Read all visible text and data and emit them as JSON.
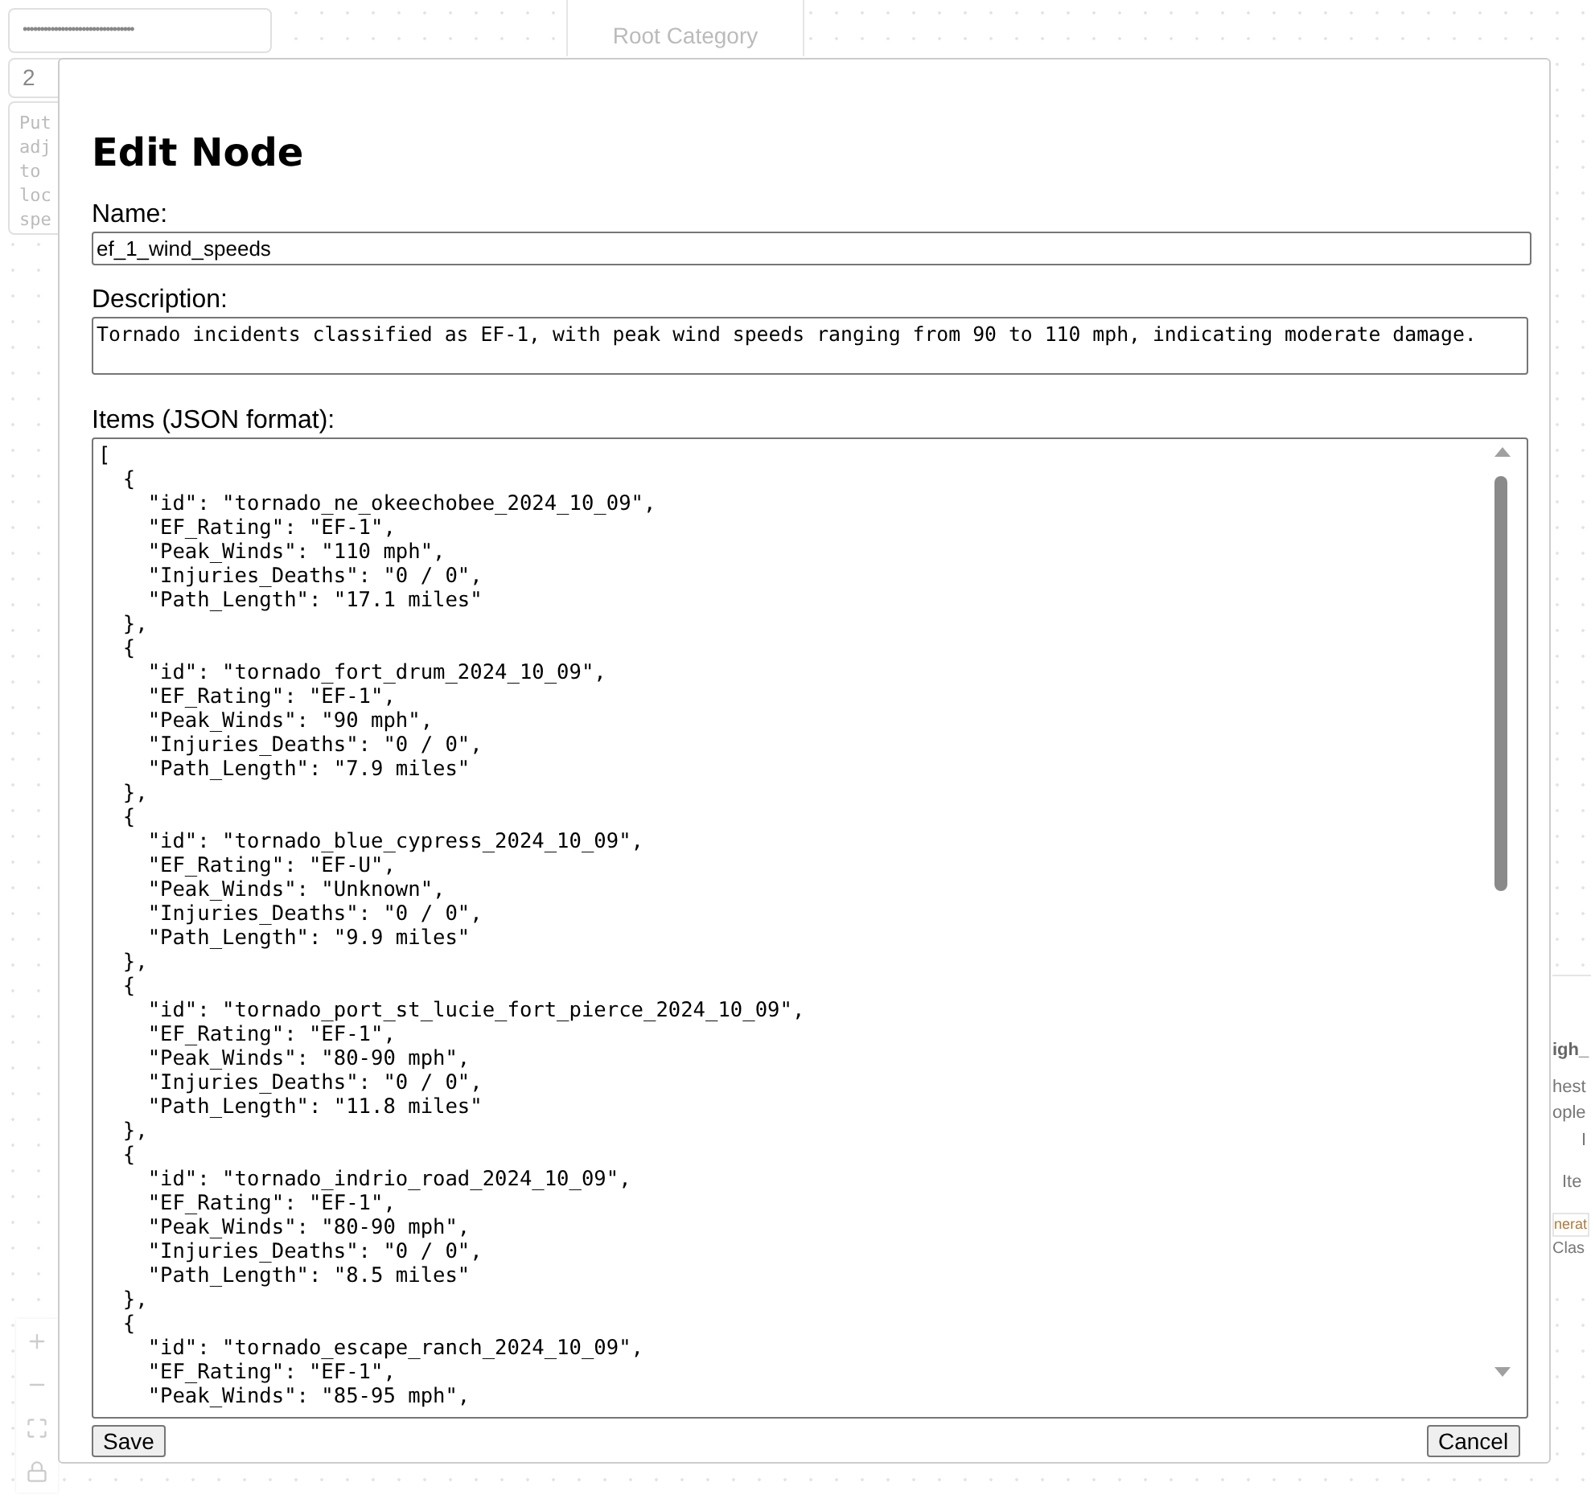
{
  "background": {
    "password_field": {
      "value": "••••••••••••••••••••••••••••••••"
    },
    "number_field": {
      "value": "2"
    },
    "prompt_lines": [
      "Put",
      "adj",
      "to",
      "loc",
      "spe"
    ],
    "root_node": {
      "label": "Root Category"
    },
    "side_node": {
      "title": "igh_",
      "lines": [
        "hest",
        "ople"
      ],
      "count": "I",
      "items_label": "Ite",
      "action": "nerat",
      "footer": "Clas"
    }
  },
  "dialog": {
    "title": "Edit Node",
    "name": {
      "label": "Name:",
      "value": "ef_1_wind_speeds"
    },
    "description": {
      "label": "Description:",
      "value": "Tornado incidents classified as EF-1, with peak wind speeds ranging from 90 to 110 mph, indicating moderate damage."
    },
    "items": {
      "label": "Items (JSON format):",
      "lines": [
        "[",
        "  {",
        "    \"id\": \"tornado_ne_okeechobee_2024_10_09\",",
        "    \"EF_Rating\": \"EF-1\",",
        "    \"Peak_Winds\": \"110 mph\",",
        "    \"Injuries_Deaths\": \"0 / 0\",",
        "    \"Path_Length\": \"17.1 miles\"",
        "  },",
        "  {",
        "    \"id\": \"tornado_fort_drum_2024_10_09\",",
        "    \"EF_Rating\": \"EF-1\",",
        "    \"Peak_Winds\": \"90 mph\",",
        "    \"Injuries_Deaths\": \"0 / 0\",",
        "    \"Path_Length\": \"7.9 miles\"",
        "  },",
        "  {",
        "    \"id\": \"tornado_blue_cypress_2024_10_09\",",
        "    \"EF_Rating\": \"EF-U\",",
        "    \"Peak_Winds\": \"Unknown\",",
        "    \"Injuries_Deaths\": \"0 / 0\",",
        "    \"Path_Length\": \"9.9 miles\"",
        "  },",
        "  {",
        "    \"id\": \"tornado_port_st_lucie_fort_pierce_2024_10_09\",",
        "    \"EF_Rating\": \"EF-1\",",
        "    \"Peak_Winds\": \"80-90 mph\",",
        "    \"Injuries_Deaths\": \"0 / 0\",",
        "    \"Path_Length\": \"11.8 miles\"",
        "  },",
        "  {",
        "    \"id\": \"tornado_indrio_road_2024_10_09\",",
        "    \"EF_Rating\": \"EF-1\",",
        "    \"Peak_Winds\": \"80-90 mph\",",
        "    \"Injuries_Deaths\": \"0 / 0\",",
        "    \"Path_Length\": \"8.5 miles\"",
        "  },",
        "  {",
        "    \"id\": \"tornado_escape_ranch_2024_10_09\",",
        "    \"EF_Rating\": \"EF-1\",",
        "    \"Peak_Winds\": \"85-95 mph\","
      ]
    },
    "buttons": [
      {
        "kind": "save",
        "label": "Save"
      },
      {
        "kind": "cancel",
        "label": "Cancel"
      }
    ]
  }
}
